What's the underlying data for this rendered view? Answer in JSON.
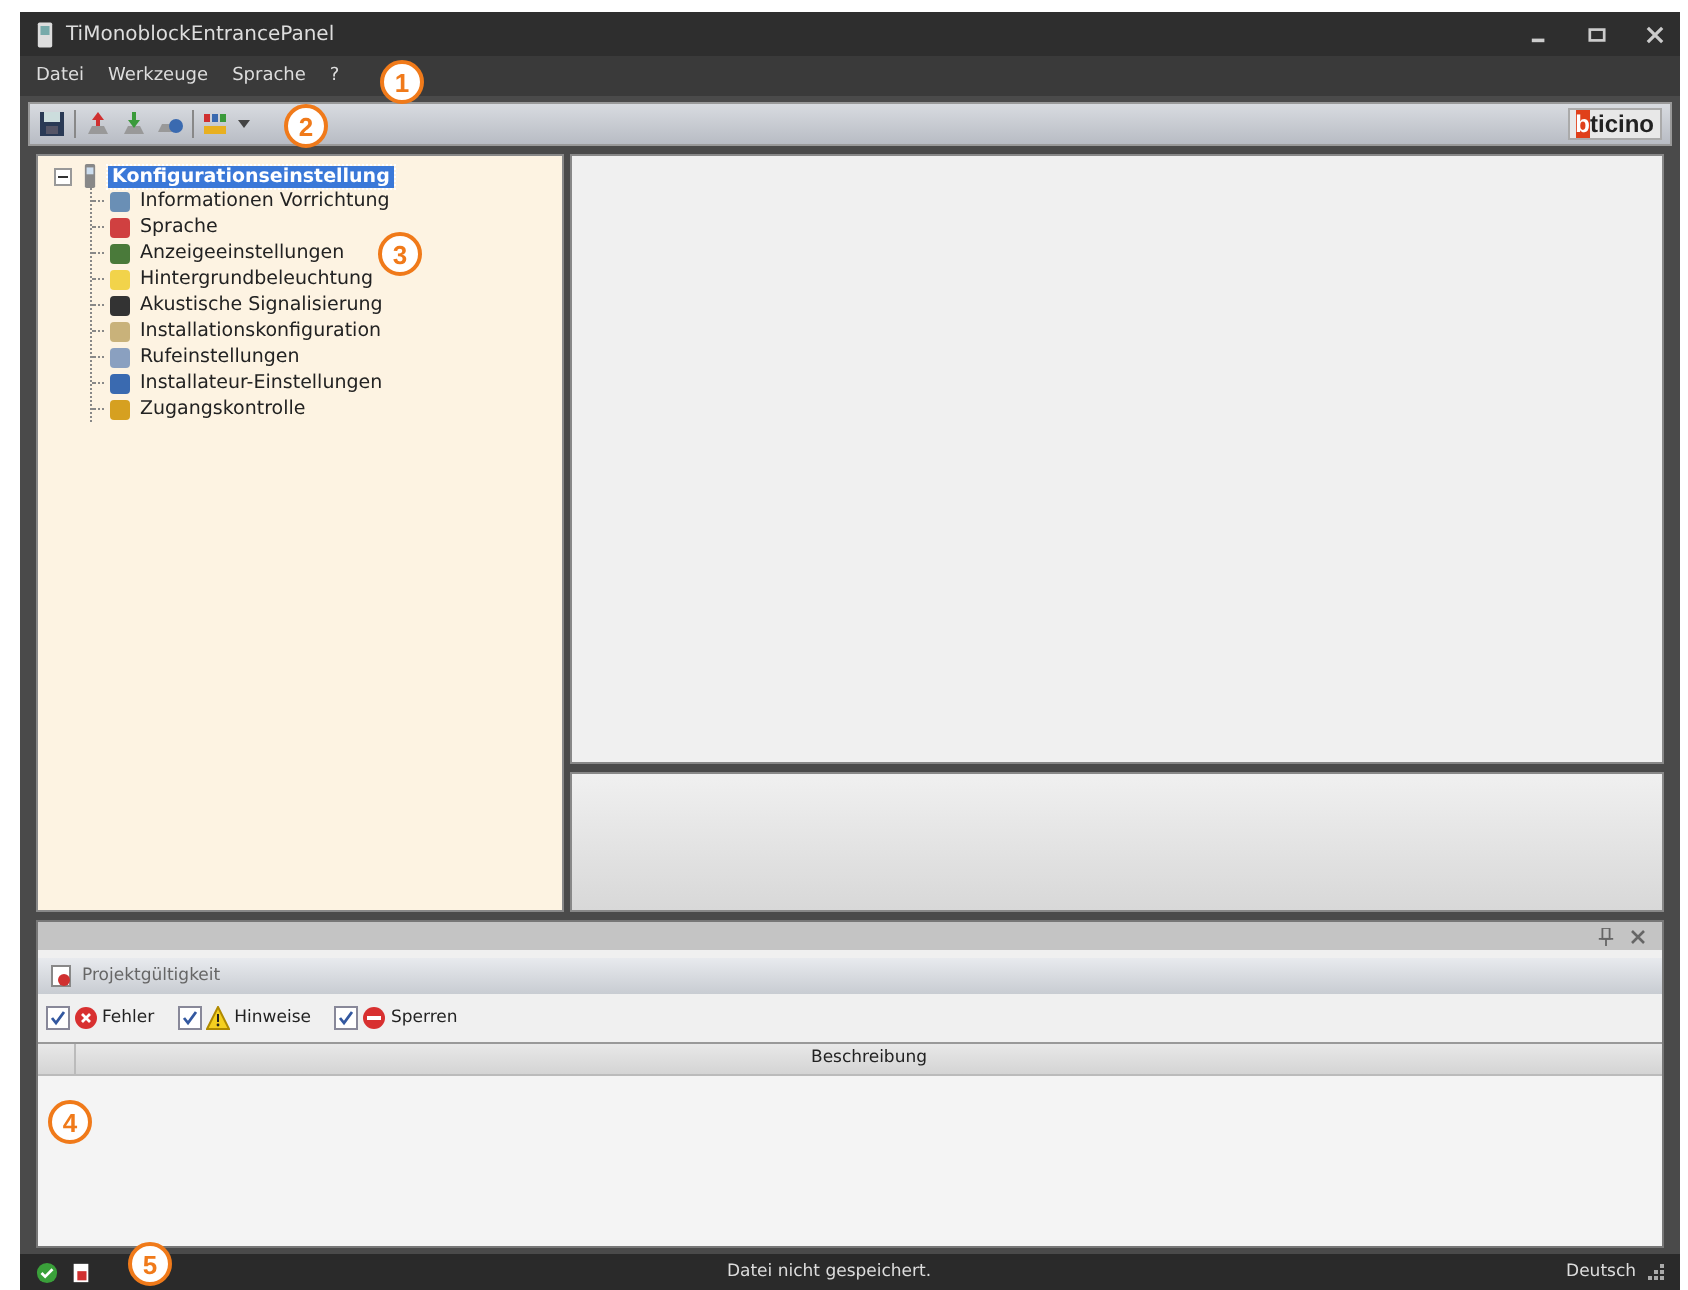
{
  "window": {
    "title": "TiMonoblockEntrancePanel"
  },
  "menu": [
    "Datei",
    "Werkzeuge",
    "Sprache",
    "?"
  ],
  "logo": {
    "accent": "b",
    "rest": "ticino"
  },
  "tree": {
    "label": "Konfigurationseinstellung",
    "expanded": true,
    "selected": true,
    "children": [
      {
        "label": "Informationen Vorrichtung",
        "selected": false
      },
      {
        "label": "Sprache",
        "selected": false
      },
      {
        "label": "Anzeigeeinstellungen",
        "selected": false
      },
      {
        "label": "Hintergrundbeleuchtung",
        "selected": false
      },
      {
        "label": "Akustische Signalisierung",
        "selected": false
      },
      {
        "label": "Installationskonfiguration",
        "selected": false
      },
      {
        "label": "Rufeinstellungen",
        "selected": false
      },
      {
        "label": "Installateur-Einstellungen",
        "selected": false
      },
      {
        "label": "Zugangskontrolle",
        "selected": false
      }
    ]
  },
  "validity_panel": {
    "tab": "Projektgültigkeit",
    "filters": [
      {
        "label": "Fehler",
        "kind": "error",
        "checked": true
      },
      {
        "label": "Hinweise",
        "kind": "warning",
        "checked": true
      },
      {
        "label": "Sperren",
        "kind": "block",
        "checked": true
      }
    ],
    "columns": [
      "Beschreibung"
    ]
  },
  "status_bar": {
    "message": "Datei nicht gespeichert.",
    "language": "Deutsch"
  },
  "callouts": [
    "1",
    "2",
    "3",
    "4",
    "5"
  ]
}
